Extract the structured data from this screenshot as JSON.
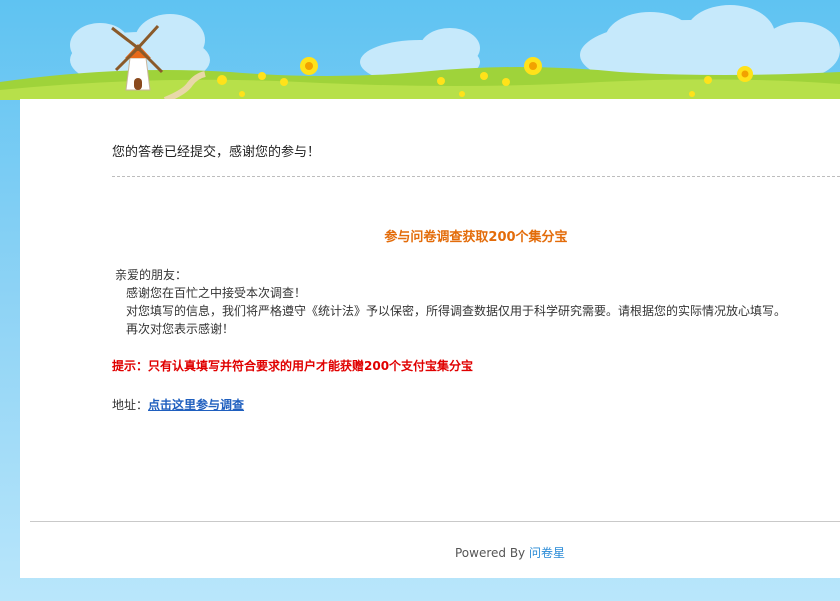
{
  "confirmation_message": "您的答卷已经提交，感谢您的参与！",
  "promo_title": "参与问卷调查获取200个集分宝",
  "letter": {
    "greeting": "亲爱的朋友：",
    "line1": "感谢您在百忙之中接受本次调查！",
    "line2": "对您填写的信息，我们将严格遵守《统计法》予以保密，所得调查数据仅用于科学研究需要。请根据您的实际情况放心填写。",
    "line3": "再次对您表示感谢！"
  },
  "tip": "提示：只有认真填写并符合要求的用户才能获赠200个支付宝集分宝",
  "address": {
    "label": "地址：",
    "link_text": "点击这里参与调查"
  },
  "footer": {
    "powered_by": "Powered By",
    "brand": "问卷星"
  },
  "colors": {
    "sky": "#5fc3f2",
    "promo_title": "#e36c0a",
    "tip": "#e00000",
    "link": "#1f5fbf",
    "brand_link": "#2a8bd6"
  }
}
